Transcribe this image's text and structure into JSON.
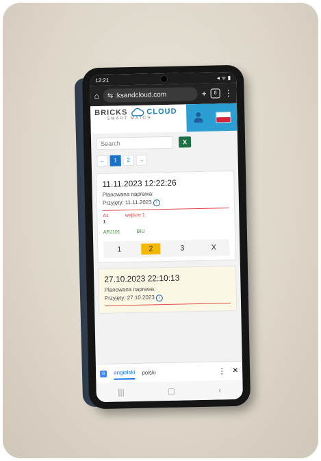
{
  "status": {
    "time": "12:21",
    "icons": "◂ ᯤ ▮"
  },
  "browser": {
    "url": "⇆ :ksandcloud.com",
    "tab_count": "8",
    "home": "⌂",
    "new_tab": "+",
    "menu": "⋮"
  },
  "site": {
    "logo_left": "BRICKS",
    "logo_right": "CLOUD",
    "logo_sub": "SMART MATCH"
  },
  "search": {
    "placeholder": "Search",
    "excel": "X"
  },
  "pagination": {
    "prev": "←",
    "pages": [
      "1",
      "2"
    ],
    "next": "→"
  },
  "cards": [
    {
      "date": "11.11.2023 12:22:26",
      "planned": "Planowana naprawa:",
      "accepted": "Przyjęty: 11.11.2023",
      "code": "A1",
      "entry": "wejście 1",
      "value": "1",
      "part": "ARJ101",
      "color": "BIU",
      "options": [
        "1",
        "2",
        "3",
        "X"
      ]
    },
    {
      "date": "27.10.2023 22:10:13",
      "planned": "Planowana naprawa:",
      "accepted": "Przyjęty: 27.10.2023"
    }
  ],
  "translate": {
    "lang_en": "angielski",
    "lang_pl": "polski",
    "more": "⋮",
    "close": "✕"
  },
  "nav": {
    "recents": "|||",
    "home": "▢",
    "back": "‹"
  }
}
